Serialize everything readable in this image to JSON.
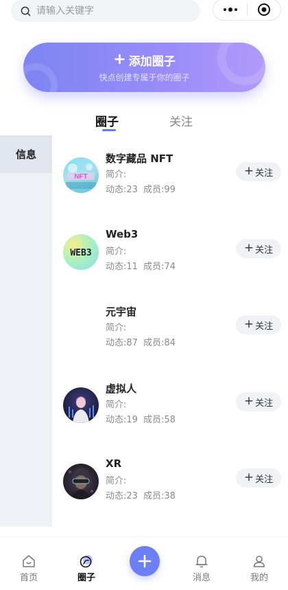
{
  "search": {
    "placeholder": "请输入关键字"
  },
  "banner": {
    "title": "添加圈子",
    "subtitle": "快点创建专属于你的圈子"
  },
  "tabs": [
    {
      "label": "圈子",
      "active": true
    },
    {
      "label": "关注",
      "active": false
    }
  ],
  "sidebar": {
    "items": [
      {
        "label": "信息",
        "active": true
      }
    ]
  },
  "follow_label": "关注",
  "circles": [
    {
      "name": "数字藏品 NFT",
      "intro": "简介:",
      "posts_label": "动态:23",
      "members_label": "成员:99",
      "avatar_icon": "nft-avatar"
    },
    {
      "name": "Web3",
      "intro": "简介:",
      "posts_label": "动态:11",
      "members_label": "成员:74",
      "avatar_icon": "web3-avatar",
      "avatar_text": "WEB3"
    },
    {
      "name": "元宇宙",
      "intro": "简介:",
      "posts_label": "动态:87",
      "members_label": "成员:84",
      "avatar_icon": "blank-avatar"
    },
    {
      "name": "虚拟人",
      "intro": "简介:",
      "posts_label": "动态:19",
      "members_label": "成员:58",
      "avatar_icon": "virtual-human-avatar"
    },
    {
      "name": "XR",
      "intro": "简介:",
      "posts_label": "动态:23",
      "members_label": "成员:38",
      "avatar_icon": "xr-avatar"
    }
  ],
  "nav": {
    "items": [
      {
        "label": "首页",
        "icon": "home-icon",
        "active": false
      },
      {
        "label": "圈子",
        "icon": "circle-icon",
        "active": true
      },
      {
        "label": "消息",
        "icon": "bell-icon",
        "active": false
      },
      {
        "label": "我的",
        "icon": "user-icon",
        "active": false
      }
    ],
    "add_icon": "plus-icon"
  },
  "colors": {
    "accent": "#6c7ff5",
    "banner_start": "#7b85f2",
    "banner_end": "#b19bfb",
    "sidebar_bg": "#eef1f5"
  }
}
